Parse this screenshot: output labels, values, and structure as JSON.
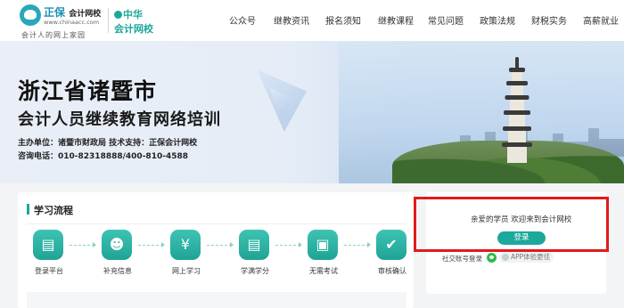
{
  "header": {
    "logo": {
      "brand": "正保",
      "brand_sub": "会计网校",
      "url": "www.chinaacc.com",
      "slogan": "会计人的网上家园"
    },
    "partner_logo": {
      "line1": "中华",
      "line2": "会计网校"
    },
    "nav": [
      {
        "label": "公众号"
      },
      {
        "label": "继教资讯"
      },
      {
        "label": "报名须知"
      },
      {
        "label": "继教课程"
      },
      {
        "label": "常见问题"
      },
      {
        "label": "政策法规"
      },
      {
        "label": "财税实务"
      },
      {
        "label": "高薪就业"
      }
    ]
  },
  "banner": {
    "title": "浙江省诸暨市",
    "subtitle": "会计人员继续教育网络培训",
    "organizer": "主办单位：诸暨市财政局  技术支持：正保会计网校",
    "phone": "咨询电话：010-82318888/400-810-4588"
  },
  "process": {
    "title": "学习流程",
    "steps": [
      {
        "label": "登录平台",
        "icon": "id-card-icon"
      },
      {
        "label": "补充信息",
        "icon": "user-check-icon"
      },
      {
        "label": "网上学习",
        "icon": "yen-bag-icon"
      },
      {
        "label": "学满学分",
        "icon": "certificate-icon"
      },
      {
        "label": "无需考试",
        "icon": "monitor-icon"
      },
      {
        "label": "审核确认",
        "icon": "thumbs-up-icon"
      }
    ]
  },
  "login": {
    "welcome": "亲爱的学员 欢迎来到会计网校",
    "button": "登录",
    "social_label": "社交账号登录",
    "app_label": "APP体验更佳"
  },
  "colors": {
    "accent": "#1ca89a",
    "highlight": "#e11b1b"
  }
}
